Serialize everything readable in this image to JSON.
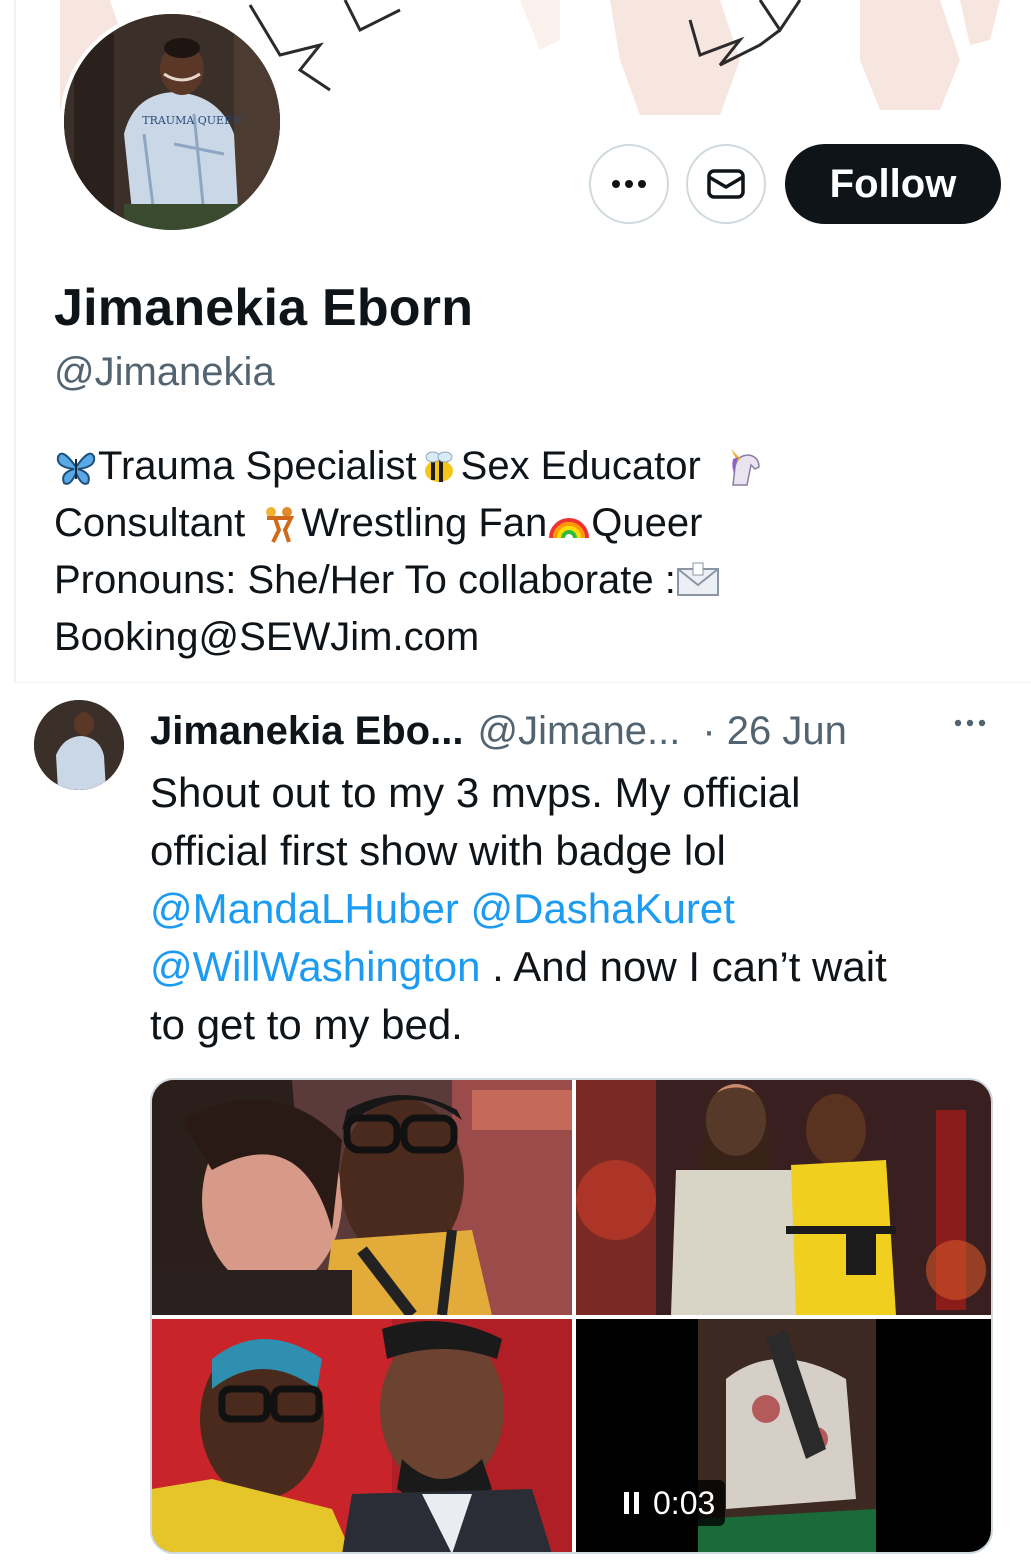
{
  "profile": {
    "display_name": "Jimanekia Eborn",
    "handle": "@Jimanekia",
    "avatar_shirt_text": "TRAUMA QUEEN",
    "bio": {
      "line1_a": "Trauma Specialist",
      "line1_b": "Sex Educator",
      "line2_a": "Consultant",
      "line2_b": "Wrestling Fan",
      "line2_c": "Queer",
      "line3": "Pronouns: She/Her To collaborate :",
      "line4": "Booking@SEWJim.com"
    },
    "emoji_icons": [
      "butterfly-icon",
      "bee-icon",
      "unicorn-icon",
      "wrestlers-icon",
      "rainbow-icon",
      "envelope-icon"
    ]
  },
  "actions": {
    "more_label": "More",
    "message_label": "Message",
    "follow_label": "Follow"
  },
  "tweet": {
    "author_name": "Jimanekia Ebo...",
    "author_handle": "@Jimane...",
    "date": "· 26 Jun",
    "text_line1": "Shout out to my 3 mvps. My official",
    "text_line2": "official first show with badge lol",
    "mention1": "@MandaLHuber",
    "mention2": "@DashaKuret",
    "mention3": "@WillWashington",
    "text_after_mention": " . And now I can’t wait",
    "text_line5": "to get to my bed.",
    "video_time": "0:03"
  },
  "colors": {
    "accent": "#1d9bf0",
    "text_primary": "#0f1419",
    "text_secondary": "#536471",
    "follow_bg": "#0f1419",
    "border": "#cfd9de"
  }
}
